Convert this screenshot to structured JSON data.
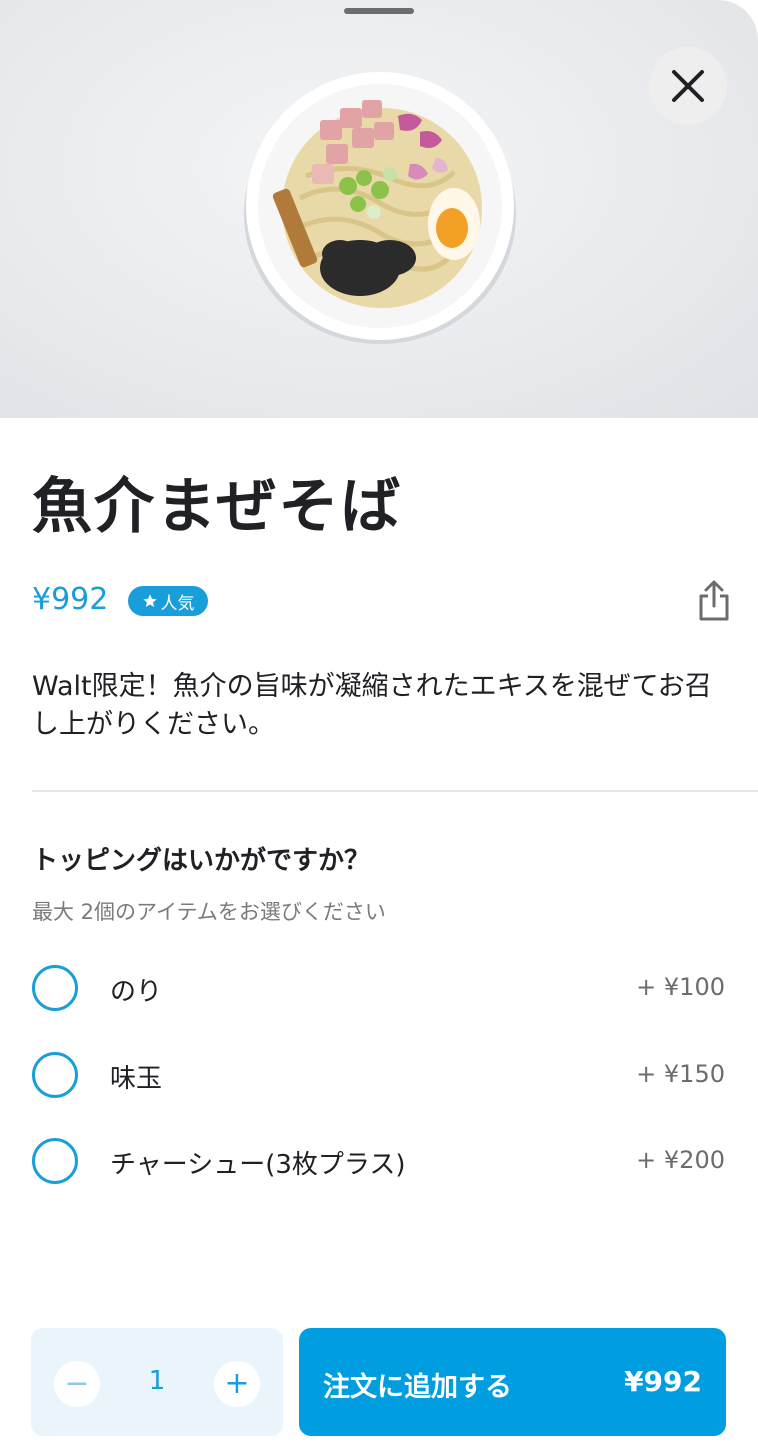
{
  "item": {
    "title": "魚介まぜそば",
    "price": "¥992",
    "badge": "人気",
    "badge_icon": "star-icon",
    "description": "Walt限定！魚介の旨味が凝縮されたエキスを混ぜてお召し上がりください。"
  },
  "toppings": {
    "title": "トッピングはいかがですか？",
    "subtitle": "最大 2個のアイテムをお選びください",
    "options": [
      {
        "label": "のり",
        "price": "+ ¥100"
      },
      {
        "label": "味玉",
        "price": "+ ¥150"
      },
      {
        "label": "チャーシュー(3枚プラス)",
        "price": "+ ¥200"
      }
    ]
  },
  "order": {
    "quantity": "1",
    "minus": "−",
    "plus": "+",
    "add_label": "注文に追加する",
    "add_price": "¥992"
  },
  "colors": {
    "accent": "#009de0",
    "stepper_bg": "#eaf5fb"
  },
  "icons": [
    "close-icon",
    "share-icon",
    "star-icon",
    "minus-icon",
    "plus-icon"
  ]
}
